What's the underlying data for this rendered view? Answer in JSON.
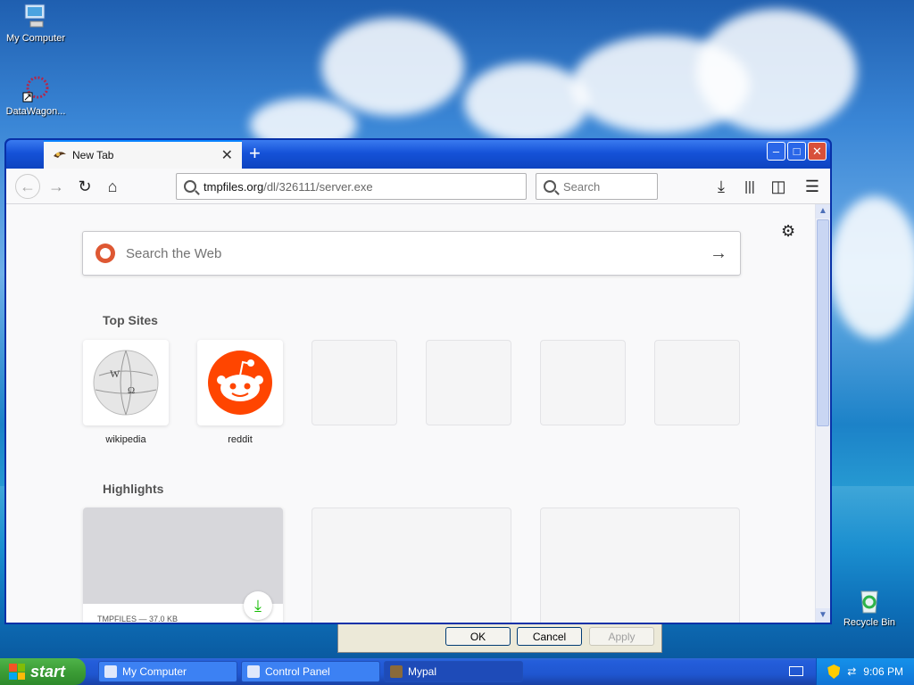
{
  "desktop": {
    "icons": [
      {
        "label": "My Computer"
      },
      {
        "label": "DataWagon..."
      },
      {
        "label": "Recycle Bin"
      }
    ]
  },
  "browser": {
    "tab": {
      "title": "New Tab"
    },
    "url": {
      "host": "tmpfiles.org",
      "path": "/dl/326111/server.exe"
    },
    "search_placeholder": "Search",
    "web_search_placeholder": "Search the Web",
    "top_sites_title": "Top Sites",
    "top_sites": [
      {
        "label": "wikipedia",
        "icon": "wikipedia-globe-icon"
      },
      {
        "label": "reddit",
        "icon": "reddit-alien-icon"
      },
      {
        "label": ""
      },
      {
        "label": ""
      },
      {
        "label": ""
      },
      {
        "label": ""
      }
    ],
    "highlights_title": "Highlights",
    "highlights": [
      {
        "meta": "TMPFILES — 37.0 KB",
        "badge_icon": "download-icon"
      }
    ]
  },
  "dialog": {
    "ok": "OK",
    "cancel": "Cancel",
    "apply": "Apply"
  },
  "taskbar": {
    "start": "start",
    "tasks": [
      {
        "label": "My Computer"
      },
      {
        "label": "Control Panel"
      },
      {
        "label": "Mypal"
      }
    ],
    "clock": "9:06 PM"
  },
  "colors": {
    "accent": "#0a84ff",
    "reddit": "#ff4500",
    "download_green": "#12bc00"
  }
}
